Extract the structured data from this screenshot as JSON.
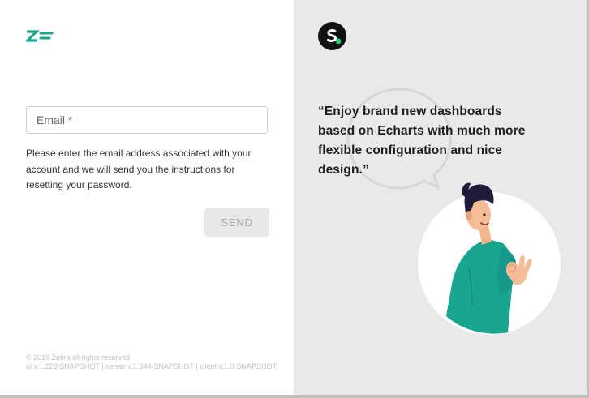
{
  "form": {
    "email_placeholder": "Email *",
    "email_value": "",
    "help_text": "Please enter the email address associated with your account and we will send you the instructions for resetting your password.",
    "send_label": "SEND"
  },
  "footer": {
    "copyright": "© 2019 Zafira all rights reserved",
    "versions": "ui v.1.228-SNAPSHOT | server v.1.344-SNAPSHOT | client v.1.0-SNAPSHOT"
  },
  "promo": {
    "quote": "“Enjoy brand new dashboards based on Echarts with much more flexible configuration and nice design.”"
  },
  "icons": {
    "app_logo": "zafira-logo-icon",
    "brand_logo": "s-logo-icon"
  },
  "colors": {
    "accent_teal": "#1aa58f",
    "send_disabled_bg": "#e8e8e8",
    "right_panel_bg": "#e9e9ea",
    "brand_dot": "#2bd26a"
  }
}
